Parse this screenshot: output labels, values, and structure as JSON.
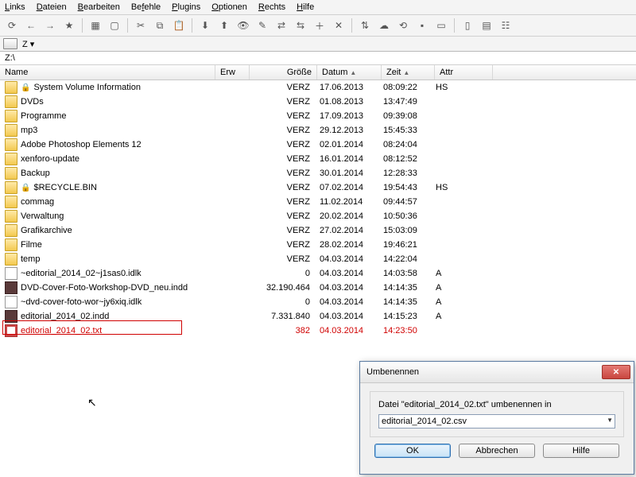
{
  "menu": {
    "links": "Links",
    "dateien": "Dateien",
    "bearbeiten": "Bearbeiten",
    "befehle": "Befehle",
    "plugins": "Plugins",
    "optionen": "Optionen",
    "rechts": "Rechts",
    "hilfe": "Hilfe"
  },
  "drive": {
    "letter": "Z",
    "path": "Z:\\"
  },
  "columns": {
    "name": "Name",
    "erw": "Erw",
    "size": "Größe",
    "date": "Datum",
    "time": "Zeit",
    "attr": "Attr"
  },
  "rows": [
    {
      "icon": "folder-lock",
      "name": "System Volume Information",
      "size": "VERZ",
      "date": "17.06.2013",
      "time": "08:09:22",
      "attr": "HS"
    },
    {
      "icon": "folder",
      "name": "DVDs",
      "size": "VERZ",
      "date": "01.08.2013",
      "time": "13:47:49",
      "attr": ""
    },
    {
      "icon": "folder",
      "name": "Programme",
      "size": "VERZ",
      "date": "17.09.2013",
      "time": "09:39:08",
      "attr": ""
    },
    {
      "icon": "folder",
      "name": "mp3",
      "size": "VERZ",
      "date": "29.12.2013",
      "time": "15:45:33",
      "attr": ""
    },
    {
      "icon": "folder",
      "name": "Adobe Photoshop Elements 12",
      "size": "VERZ",
      "date": "02.01.2014",
      "time": "08:24:04",
      "attr": ""
    },
    {
      "icon": "folder",
      "name": "xenforo-update",
      "size": "VERZ",
      "date": "16.01.2014",
      "time": "08:12:52",
      "attr": ""
    },
    {
      "icon": "folder",
      "name": "Backup",
      "size": "VERZ",
      "date": "30.01.2014",
      "time": "12:28:33",
      "attr": ""
    },
    {
      "icon": "folder-lock",
      "name": "$RECYCLE.BIN",
      "size": "VERZ",
      "date": "07.02.2014",
      "time": "19:54:43",
      "attr": "HS"
    },
    {
      "icon": "folder",
      "name": "commag",
      "size": "VERZ",
      "date": "11.02.2014",
      "time": "09:44:57",
      "attr": ""
    },
    {
      "icon": "folder",
      "name": "Verwaltung",
      "size": "VERZ",
      "date": "20.02.2014",
      "time": "10:50:36",
      "attr": ""
    },
    {
      "icon": "folder",
      "name": "Grafikarchive",
      "size": "VERZ",
      "date": "27.02.2014",
      "time": "15:03:09",
      "attr": ""
    },
    {
      "icon": "folder",
      "name": "Filme",
      "size": "VERZ",
      "date": "28.02.2014",
      "time": "19:46:21",
      "attr": ""
    },
    {
      "icon": "folder",
      "name": "temp",
      "size": "VERZ",
      "date": "04.03.2014",
      "time": "14:22:04",
      "attr": ""
    },
    {
      "icon": "file",
      "name": "~editorial_2014_02~j1sas0.idlk",
      "size": "0",
      "date": "04.03.2014",
      "time": "14:03:58",
      "attr": "A"
    },
    {
      "icon": "file-dark",
      "name": "DVD-Cover-Foto-Workshop-DVD_neu.indd",
      "size": "32.190.464",
      "date": "04.03.2014",
      "time": "14:14:35",
      "attr": "A"
    },
    {
      "icon": "file",
      "name": "~dvd-cover-foto-wor~jy6xiq.idlk",
      "size": "0",
      "date": "04.03.2014",
      "time": "14:14:35",
      "attr": "A"
    },
    {
      "icon": "file-dark",
      "name": "editorial_2014_02.indd",
      "size": "7.331.840",
      "date": "04.03.2014",
      "time": "14:15:23",
      "attr": "A"
    },
    {
      "icon": "file-red",
      "name": "editorial_2014_02.txt",
      "size": "382",
      "date": "04.03.2014",
      "time": "14:23:50",
      "attr": "",
      "selected": true
    }
  ],
  "dialog": {
    "title": "Umbenennen",
    "prompt": "Datei \"editorial_2014_02.txt\" umbenennen in",
    "value": "editorial_2014_02.csv",
    "ok": "OK",
    "cancel": "Abbrechen",
    "help": "Hilfe"
  }
}
